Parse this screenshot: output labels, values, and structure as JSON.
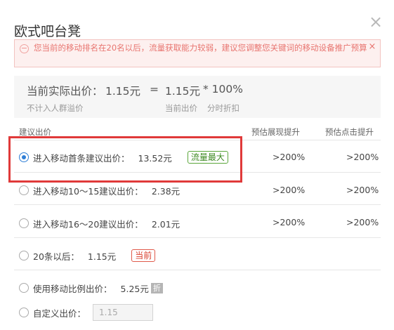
{
  "dialog": {
    "title": "欧式吧台凳",
    "close_icon": "close-icon"
  },
  "alert": {
    "icon": "minus-circle-icon",
    "message": "您当前的移动排名在20名以后，流量获取能力较弱，建议您调整您关键词的移动设备推广预算",
    "close_label": "×"
  },
  "summary": {
    "label": "当前实际出价：",
    "actual_price": "1.15元",
    "equals": "=",
    "current_bid": "1.15元",
    "multiplier": "* 100%",
    "sub_left": "不计入人群溢价",
    "sub_mid": "当前出价",
    "sub_right": "分时折扣"
  },
  "table": {
    "headers": [
      "建议出价",
      "预估展现提升",
      "预估点击提升"
    ],
    "options": [
      {
        "label": "进入移动首条建议出价：",
        "price": "13.52元",
        "tag": "流量最大",
        "show": ">200%",
        "click": ">200%",
        "selected": true
      },
      {
        "label": "进入移动10～15建议出价：",
        "price": "2.38元",
        "show": ">200%",
        "click": ">200%",
        "selected": false
      },
      {
        "label": "进入移动16～20建议出价：",
        "price": "2.01元",
        "show": ">200%",
        "click": ">200%",
        "selected": false
      },
      {
        "label": "20条以后：",
        "price": "1.15元",
        "tag": "当前",
        "selected": false
      },
      {
        "label": "使用移动比例出价：",
        "price": "5.25元",
        "tag": "折",
        "selected": false
      },
      {
        "label": "自定义出价：",
        "input_value": "1.15",
        "selected": false
      }
    ]
  },
  "colors": {
    "accent_orange": "#e8580c",
    "radio_blue": "#2f7fd6",
    "highlight_red": "#e03a3a",
    "tag_green": "#3e8a22",
    "alert_text": "#e8746f"
  }
}
